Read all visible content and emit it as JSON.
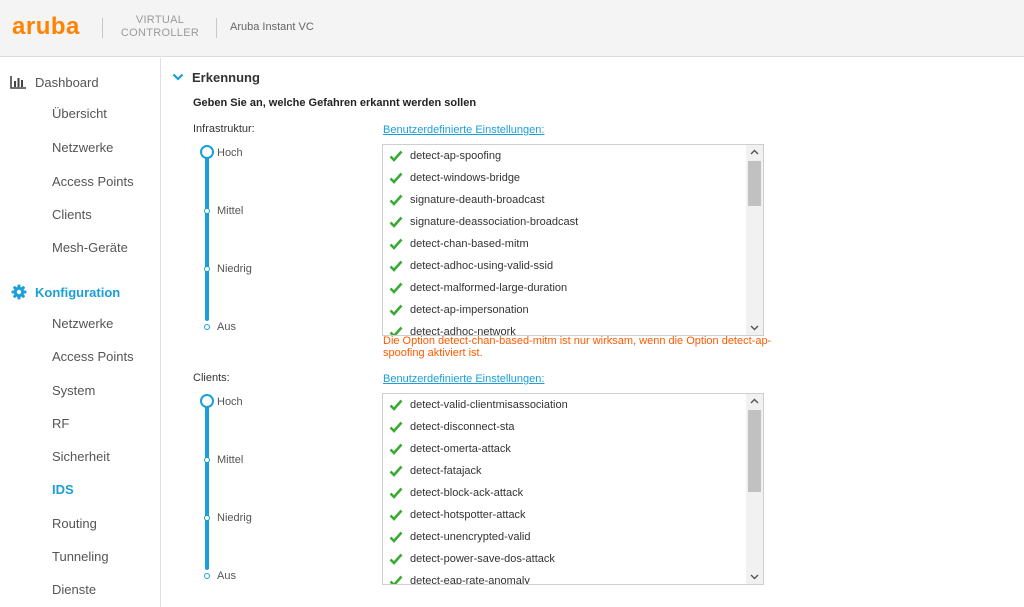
{
  "header": {
    "logo": "aruba",
    "vc_line1": "VIRTUAL",
    "vc_line2": "CONTROLLER",
    "vc_name": "Aruba Instant VC",
    "brand_color": "#ff8300"
  },
  "sidebar": {
    "dashboard": {
      "label": "Dashboard",
      "icon": "bar-chart-icon",
      "items": [
        "Übersicht",
        "Netzwerke",
        "Access Points",
        "Clients",
        "Mesh-Geräte"
      ]
    },
    "config": {
      "label": "Konfiguration",
      "icon": "gear-icon",
      "items": [
        "Netzwerke",
        "Access Points",
        "System",
        "RF",
        "Sicherheit",
        "IDS",
        "Routing",
        "Tunneling",
        "Dienste"
      ],
      "active_item": "IDS"
    },
    "accent_color": "#1a9fd9"
  },
  "main": {
    "section_title": "Erkennung",
    "instruction": "Geben Sie an, welche Gefahren erkannt werden sollen",
    "infra": {
      "label": "Infrastruktur:",
      "custom_link": "Benutzerdefinierte Einstellungen:",
      "levels": [
        "Hoch",
        "Mittel",
        "Niedrig",
        "Aus"
      ],
      "selected_level": "Hoch",
      "items": [
        "detect-ap-spoofing",
        "detect-windows-bridge",
        "signature-deauth-broadcast",
        "signature-deassociation-broadcast",
        "detect-chan-based-mitm",
        "detect-adhoc-using-valid-ssid",
        "detect-malformed-large-duration",
        "detect-ap-impersonation",
        "detect-adhoc-network"
      ]
    },
    "warning": "Die Option detect-chan-based-mitm ist nur wirksam, wenn die Option detect-ap-spoofing aktiviert ist.",
    "warning_color": "#ff5a00",
    "clients": {
      "label": "Clients:",
      "custom_link": "Benutzerdefinierte Einstellungen:",
      "levels": [
        "Hoch",
        "Mittel",
        "Niedrig",
        "Aus"
      ],
      "selected_level": "Hoch",
      "items": [
        "detect-valid-clientmisassociation",
        "detect-disconnect-sta",
        "detect-omerta-attack",
        "detect-fatajack",
        "detect-block-ack-attack",
        "detect-hotspotter-attack",
        "detect-unencrypted-valid",
        "detect-power-save-dos-attack",
        "detect-eap-rate-anomaly"
      ]
    },
    "check_color": "#3aaa35"
  }
}
